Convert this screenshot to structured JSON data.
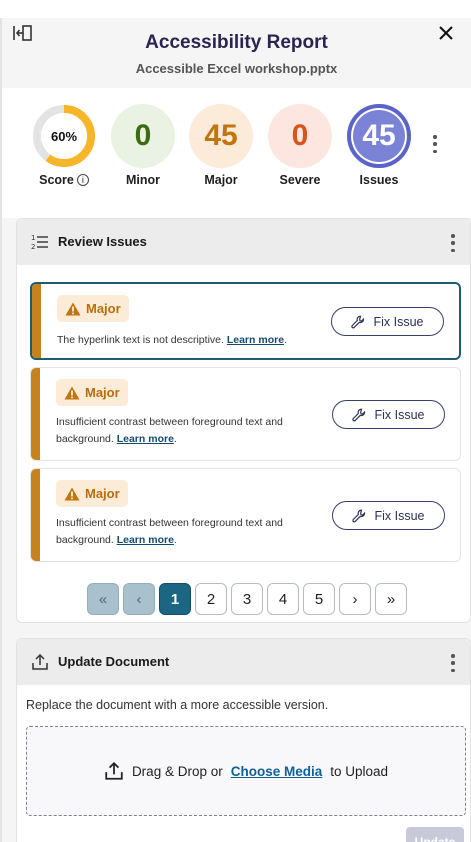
{
  "header": {
    "title": "Accessibility Report",
    "filename": "Accessible Excel workshop.pptx",
    "collapse_icon": "collapse-panel-icon",
    "close_icon": "close-icon"
  },
  "metrics": {
    "score": {
      "value": "60%",
      "fraction": 0.6,
      "label": "Score",
      "ring_color": "#f7b529",
      "track_color": "#e3e3e3"
    },
    "minor": {
      "value": "0",
      "label": "Minor",
      "color": "#3d6a13"
    },
    "major": {
      "value": "45",
      "label": "Major",
      "color": "#c0750e"
    },
    "severe": {
      "value": "0",
      "label": "Severe",
      "color": "#d9541c"
    },
    "issues": {
      "value": "45",
      "label": "Issues",
      "color": "#5b64c7"
    }
  },
  "review": {
    "title": "Review Issues",
    "issues": [
      {
        "severity": "Major",
        "text": "The hyperlink text is not descriptive.",
        "link": "Learn more",
        "fix_label": "Fix Issue"
      },
      {
        "severity": "Major",
        "text": "Insufficient contrast between foreground text and background.",
        "link": "Learn more",
        "fix_label": "Fix Issue"
      },
      {
        "severity": "Major",
        "text": "Insufficient contrast between foreground text and background.",
        "link": "Learn more",
        "fix_label": "Fix Issue"
      }
    ],
    "pagination": {
      "first": "«",
      "prev": "‹",
      "pages": [
        "1",
        "2",
        "3",
        "4",
        "5"
      ],
      "current": "1",
      "next": "›",
      "last": "»"
    }
  },
  "update": {
    "title": "Update Document",
    "description": "Replace the document with a more accessible version.",
    "drop_prefix": "Drag & Drop or",
    "drop_link": "Choose Media",
    "drop_suffix": "to Upload",
    "upload_button": "Update"
  },
  "colors": {
    "accent": "#1b6783",
    "major": "#c6821e",
    "title": "#2c2450"
  }
}
